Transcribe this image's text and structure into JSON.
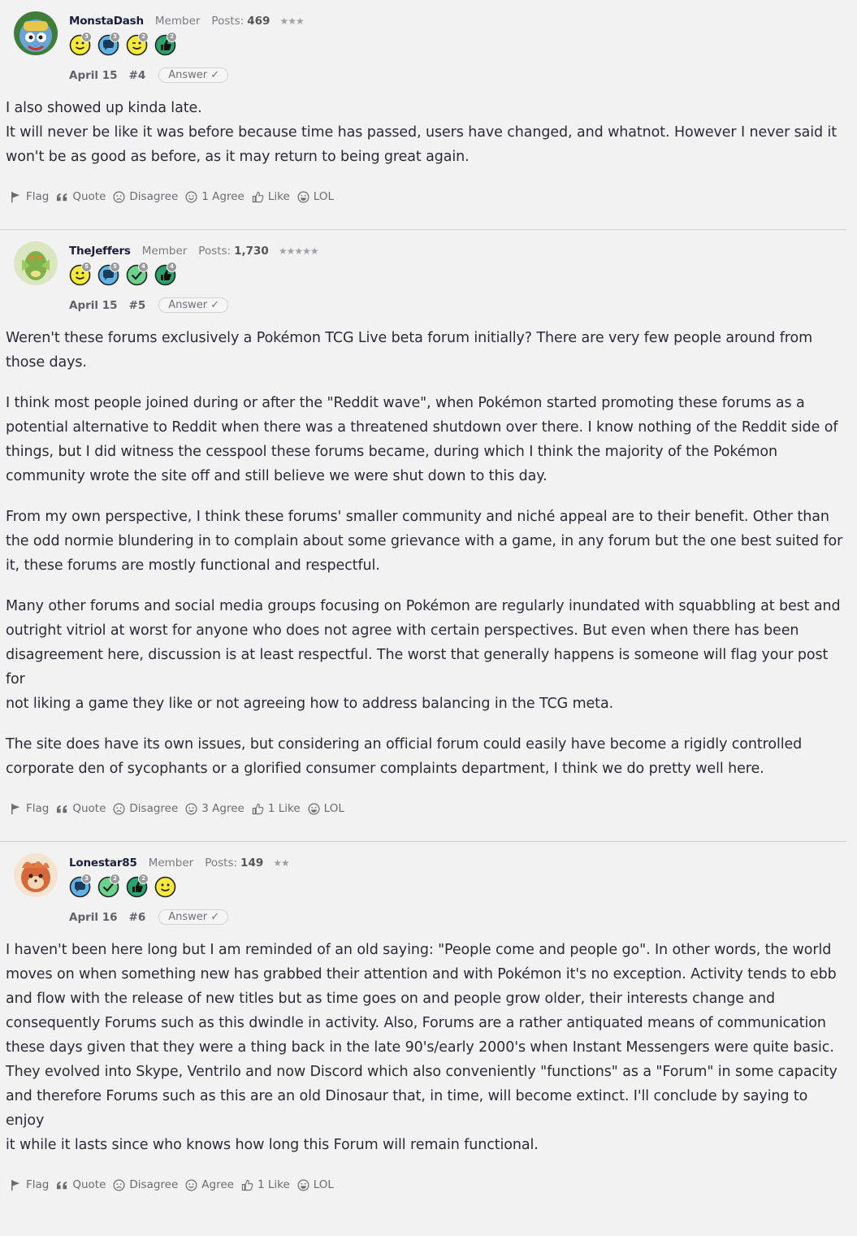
{
  "posts": [
    {
      "username": "MonstaDash",
      "role": "Member",
      "posts_label": "Posts:",
      "posts_count": "469",
      "stars": "★★★",
      "date": "April 15",
      "number": "#4",
      "answer_label": "Answer ✓",
      "badges": [
        {
          "icon": "smiley-badge-icon",
          "count": "3",
          "color": "#f7e93a"
        },
        {
          "icon": "chat-badge-icon",
          "count": "3",
          "color": "#5fb3e6"
        },
        {
          "icon": "wink-badge-icon",
          "count": "2",
          "color": "#f7e93a"
        },
        {
          "icon": "thumbs-badge-icon",
          "count": "2",
          "color": "#27a36b"
        }
      ],
      "paragraphs": [
        [
          "I also showed up kinda late.",
          "It will never be like it was before because time has passed, users have changed, and whatnot. However I never said it",
          "won't be as good as before, as it may return to being great again."
        ]
      ],
      "actions": {
        "flag": "Flag",
        "quote": "Quote",
        "disagree": "Disagree",
        "agree": "1 Agree",
        "like": "Like",
        "lol": "LOL"
      }
    },
    {
      "username": "TheJeffers",
      "role": "Member",
      "posts_label": "Posts:",
      "posts_count": "1,730",
      "stars": "★★★★★",
      "date": "April 15",
      "number": "#5",
      "answer_label": "Answer ✓",
      "badges": [
        {
          "icon": "smiley-badge-icon",
          "count": "5",
          "color": "#f7e93a"
        },
        {
          "icon": "chat-badge-icon",
          "count": "5",
          "color": "#5fb3e6"
        },
        {
          "icon": "check-badge-icon",
          "count": "4",
          "color": "#6cd48a"
        },
        {
          "icon": "thumbs-badge-icon",
          "count": "4",
          "color": "#27a36b"
        }
      ],
      "paragraphs": [
        [
          "Weren't these forums exclusively a Pokémon TCG Live beta forum initially? There are very few people around from",
          "those days."
        ],
        [
          "I think most people joined during or after the \"Reddit wave\", when Pokémon started promoting these forums as a",
          "potential alternative to Reddit when there was a threatened shutdown over there. I know nothing of the Reddit side of",
          "things, but I did witness the cesspool these forums became, during which I think the majority of the Pokémon",
          "community wrote the site off and still believe we were shut down to this day."
        ],
        [
          "From my own perspective, I think these forums' smaller community and niché appeal are to their benefit. Other than",
          "the odd normie blundering in to complain about some grievance with a game, in any forum but the one best suited for",
          "it, these forums are mostly functional and respectful."
        ],
        [
          "Many other forums and social media groups focusing on Pokémon are regularly inundated with squabbling at best and",
          "outright vitriol at worst for anyone who does not agree with certain perspectives. But even when there has been",
          "disagreement here, discussion is at least respectful. The worst that generally happens is someone will flag your post for",
          "not liking a game they like or not agreeing how to address balancing in the TCG meta."
        ],
        [
          "The site does have its own issues, but considering an official forum could easily have become a rigidly controlled",
          "corporate den of sycophants or a glorified consumer complaints department, I think we do pretty well here."
        ]
      ],
      "actions": {
        "flag": "Flag",
        "quote": "Quote",
        "disagree": "Disagree",
        "agree": "3 Agree",
        "like": "1 Like",
        "lol": "LOL"
      }
    },
    {
      "username": "Lonestar85",
      "role": "Member",
      "posts_label": "Posts:",
      "posts_count": "149",
      "stars": "★★",
      "date": "April 16",
      "number": "#6",
      "answer_label": "Answer ✓",
      "badges": [
        {
          "icon": "chat-badge-icon",
          "count": "3",
          "color": "#5fb3e6"
        },
        {
          "icon": "check-badge-icon",
          "count": "2",
          "color": "#6cd48a"
        },
        {
          "icon": "thumbs-badge-icon",
          "count": "2",
          "color": "#27a36b"
        },
        {
          "icon": "smiley-badge-icon",
          "count": "",
          "color": "#f7e93a"
        }
      ],
      "paragraphs": [
        [
          "I haven't been here long but I am reminded of an old saying: \"People come and people go\". In other words, the world",
          "moves on when something new has grabbed their attention and with Pokémon it's no exception. Activity tends to ebb",
          "and flow with the release of new titles but as time goes on and people grow older, their interests change and",
          "consequently Forums such as this dwindle in activity. Also, Forums are a rather antiquated means of communication",
          "these days given that they were a thing back in the late 90's/early 2000's when Instant Messengers were quite basic.",
          "They evolved into Skype, Ventrilo and now Discord which also conveniently \"functions\" as a \"Forum\" in some capacity",
          "and therefore Forums such as this are an old Dinosaur that, in time, will become extinct. I'll conclude by saying to enjoy",
          "it while it lasts since who knows how long this Forum will remain functional."
        ]
      ],
      "actions": {
        "flag": "Flag",
        "quote": "Quote",
        "disagree": "Disagree",
        "agree": "Agree",
        "like": "1 Like",
        "lol": "LOL"
      }
    }
  ]
}
